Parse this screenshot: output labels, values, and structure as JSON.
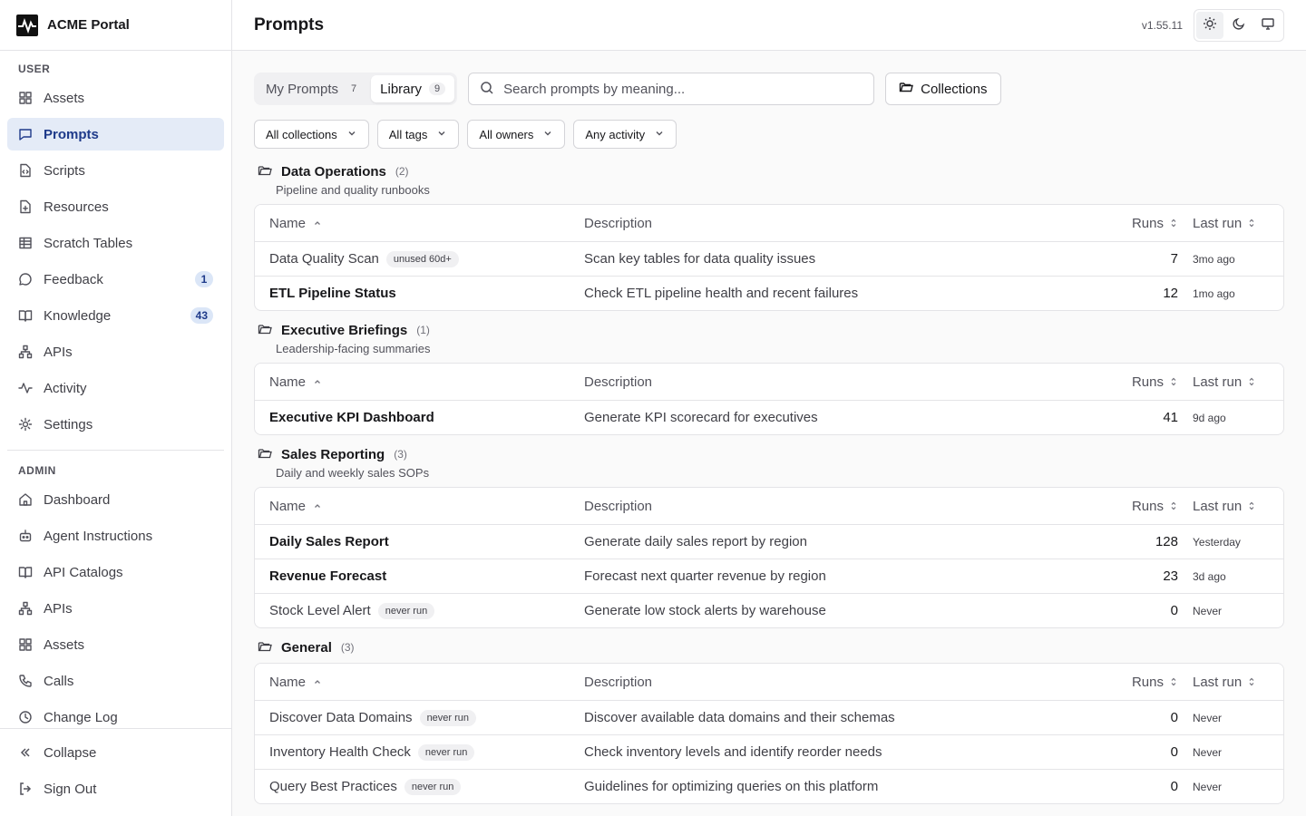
{
  "app": {
    "name": "ACME Portal",
    "version": "v1.55.11",
    "page_title": "Prompts"
  },
  "sidebar": {
    "user_label": "USER",
    "user_items": [
      {
        "label": "Assets",
        "icon": "grid-icon"
      },
      {
        "label": "Prompts",
        "icon": "message-square-icon",
        "active": true
      },
      {
        "label": "Scripts",
        "icon": "file-code-icon"
      },
      {
        "label": "Resources",
        "icon": "file-plus-icon"
      },
      {
        "label": "Scratch Tables",
        "icon": "table-icon"
      },
      {
        "label": "Feedback",
        "icon": "message-circle-icon",
        "badge": "1"
      },
      {
        "label": "Knowledge",
        "icon": "book-open-icon",
        "badge": "43"
      },
      {
        "label": "APIs",
        "icon": "network-icon"
      },
      {
        "label": "Activity",
        "icon": "activity-icon"
      },
      {
        "label": "Settings",
        "icon": "gear-icon"
      }
    ],
    "admin_label": "ADMIN",
    "admin_items": [
      {
        "label": "Dashboard",
        "icon": "home-icon"
      },
      {
        "label": "Agent Instructions",
        "icon": "bot-icon"
      },
      {
        "label": "API Catalogs",
        "icon": "book-open-icon"
      },
      {
        "label": "APIs",
        "icon": "network-icon"
      },
      {
        "label": "Assets",
        "icon": "grid-icon"
      },
      {
        "label": "Calls",
        "icon": "phone-icon"
      },
      {
        "label": "Change Log",
        "icon": "clock-icon"
      }
    ],
    "collapse_label": "Collapse",
    "signout_label": "Sign Out"
  },
  "toolbar": {
    "tabs": [
      {
        "label": "My Prompts",
        "count": "7"
      },
      {
        "label": "Library",
        "count": "9",
        "active": true
      }
    ],
    "search_placeholder": "Search prompts by meaning...",
    "collections_label": "Collections"
  },
  "filters": [
    "All collections",
    "All tags",
    "All owners",
    "Any activity"
  ],
  "table_headers": {
    "name": "Name",
    "description": "Description",
    "runs": "Runs",
    "last_run": "Last run"
  },
  "groups": [
    {
      "name": "Data Operations",
      "count": "(2)",
      "description": "Pipeline and quality runbooks",
      "rows": [
        {
          "name": "Data Quality Scan",
          "pill": "unused 60d+",
          "description": "Scan key tables for data quality issues",
          "runs": "7",
          "last_run": "3mo ago",
          "bold": false
        },
        {
          "name": "ETL Pipeline Status",
          "pill": "",
          "description": "Check ETL pipeline health and recent failures",
          "runs": "12",
          "last_run": "1mo ago",
          "bold": true
        }
      ]
    },
    {
      "name": "Executive Briefings",
      "count": "(1)",
      "description": "Leadership-facing summaries",
      "rows": [
        {
          "name": "Executive KPI Dashboard",
          "pill": "",
          "description": "Generate KPI scorecard for executives",
          "runs": "41",
          "last_run": "9d ago",
          "bold": true
        }
      ]
    },
    {
      "name": "Sales Reporting",
      "count": "(3)",
      "description": "Daily and weekly sales SOPs",
      "rows": [
        {
          "name": "Daily Sales Report",
          "pill": "",
          "description": "Generate daily sales report by region",
          "runs": "128",
          "last_run": "Yesterday",
          "bold": true
        },
        {
          "name": "Revenue Forecast",
          "pill": "",
          "description": "Forecast next quarter revenue by region",
          "runs": "23",
          "last_run": "3d ago",
          "bold": true
        },
        {
          "name": "Stock Level Alert",
          "pill": "never run",
          "description": "Generate low stock alerts by warehouse",
          "runs": "0",
          "last_run": "Never",
          "bold": false
        }
      ]
    },
    {
      "name": "General",
      "count": "(3)",
      "description": "",
      "rows": [
        {
          "name": "Discover Data Domains",
          "pill": "never run",
          "description": "Discover available data domains and their schemas",
          "runs": "0",
          "last_run": "Never",
          "bold": false
        },
        {
          "name": "Inventory Health Check",
          "pill": "never run",
          "description": "Check inventory levels and identify reorder needs",
          "runs": "0",
          "last_run": "Never",
          "bold": false
        },
        {
          "name": "Query Best Practices",
          "pill": "never run",
          "description": "Guidelines for optimizing queries on this platform",
          "runs": "0",
          "last_run": "Never",
          "bold": false
        }
      ]
    }
  ],
  "colors": {
    "accent_bg": "#e4ebf7",
    "accent_text": "#1e3a8a",
    "border": "#e4e4e7"
  }
}
